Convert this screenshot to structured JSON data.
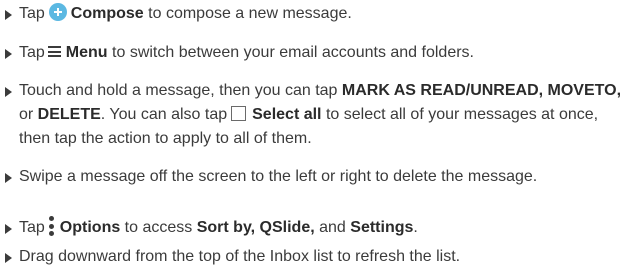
{
  "items": [
    {
      "pre": "Tap",
      "compose_label": "Compose",
      "post": " to compose a new message."
    },
    {
      "pre": "Tap",
      "menu_label": "Menu",
      "post": " to switch between your email accounts and folders."
    },
    {
      "pre": "Touch and hold a message, then you can tap ",
      "mark_label": "MARK AS READ/UNREAD,",
      "gap1": " ",
      "move_label": "MOVETO,",
      "or_text": " or ",
      "delete_label": "DELETE",
      "mid": ". You can also tap",
      "select_all_label": "Select all",
      "post": " to select all of your messages at once, then tap the action to apply to all of them."
    },
    {
      "text": "Swipe a message off the screen to the left or right to delete the message."
    },
    {
      "pre": "Tap",
      "options_label": "Options",
      "mid1": " to access ",
      "sort_label": "Sort by,",
      "gap": " ",
      "qslide_label": "QSlide,",
      "mid2": " and ",
      "settings_label": "Settings",
      "post": "."
    },
    {
      "text": "Drag downward from the top of the Inbox list to refresh the list."
    }
  ],
  "colors": {
    "text": "#3b3b3b",
    "compose_icon": "#5bb8e2"
  },
  "icons": [
    "bullet-triangle-icon",
    "compose-icon",
    "menu-icon",
    "checkbox-icon",
    "options-icon"
  ]
}
